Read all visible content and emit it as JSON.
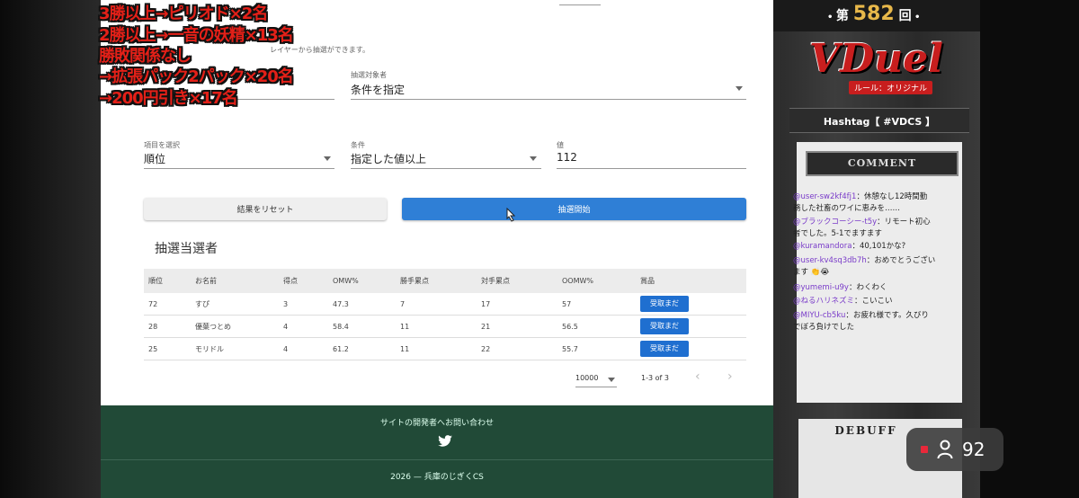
{
  "overlay_lines": [
    "3勝以上→ピリオド×2名",
    "2勝以上→一音の妖精×13名",
    "勝敗関係なし",
    "→拡張パック2パック×20名",
    "→200円引き×17名"
  ],
  "form": {
    "hint_text": "レイヤーから抽選ができます。",
    "target_label": "抽選対象者",
    "target_value": "条件を指定",
    "item_label": "項目を選択",
    "item_value": "順位",
    "condition_label": "条件",
    "condition_value": "指定した値以上",
    "value_label": "値",
    "value_value": "112"
  },
  "buttons": {
    "reset": "結果をリセット",
    "start": "抽選開始"
  },
  "winners": {
    "title": "抽選当選者",
    "columns": [
      "順位",
      "お名前",
      "得点",
      "OMW%",
      "勝手累点",
      "対手累点",
      "OOMW%",
      "賞品"
    ],
    "rows": [
      {
        "rank": "72",
        "name": "すぴ",
        "score": "3",
        "omw": "47.3",
        "a": "7",
        "b": "17",
        "oomw": "57",
        "prize": "受取まだ"
      },
      {
        "rank": "28",
        "name": "優葉つとめ",
        "score": "4",
        "omw": "58.4",
        "a": "11",
        "b": "21",
        "oomw": "56.5",
        "prize": "受取まだ"
      },
      {
        "rank": "25",
        "name": "モリドル",
        "score": "4",
        "omw": "61.2",
        "a": "11",
        "b": "22",
        "oomw": "55.7",
        "prize": "受取まだ"
      }
    ],
    "page_size": "10000",
    "range": "1-3 of 3"
  },
  "footer": {
    "contact": "サイトの開発者へお問い合わせ",
    "copyright": "2026 — 兵庫のじぎくCS"
  },
  "stream": {
    "episode_prefix": "第",
    "episode_number": "582",
    "episode_suffix": "回",
    "logo_text": "VDuel",
    "logo_sub": "ルール：オリジナル",
    "hashtag": "Hashtag【 #VDCS 】",
    "comment_header": "COMMENT",
    "comments": [
      {
        "user": "@user-sw2kf4fj1",
        "text": "：休憩なし12時間勤"
      },
      {
        "user": "",
        "text": "務した社畜のワイに恵みを……"
      },
      {
        "user": "@ブラックコーシー-t5y",
        "text": "：リモート初心"
      },
      {
        "user": "",
        "text": "者でした。5-1でますます"
      },
      {
        "user": "@kuramandora",
        "text": "：40,101かな?"
      },
      {
        "user": "@user-kv4sq3db7h",
        "text": "：おめでとうござい"
      },
      {
        "user": "",
        "text": "ます 👏😭"
      },
      {
        "user": "@yumemi-u9y",
        "text": "：わくわく"
      },
      {
        "user": "@ねるハリネズミ",
        "text": "：こいこい"
      },
      {
        "user": "@MIYU-cb5ku",
        "text": "：お疲れ様です。久びり"
      },
      {
        "user": "",
        "text": "でぼろ負けでした"
      }
    ],
    "bottom_label": "DEBUFF",
    "viewer_count": "92",
    "accent": "#e8b84a"
  }
}
